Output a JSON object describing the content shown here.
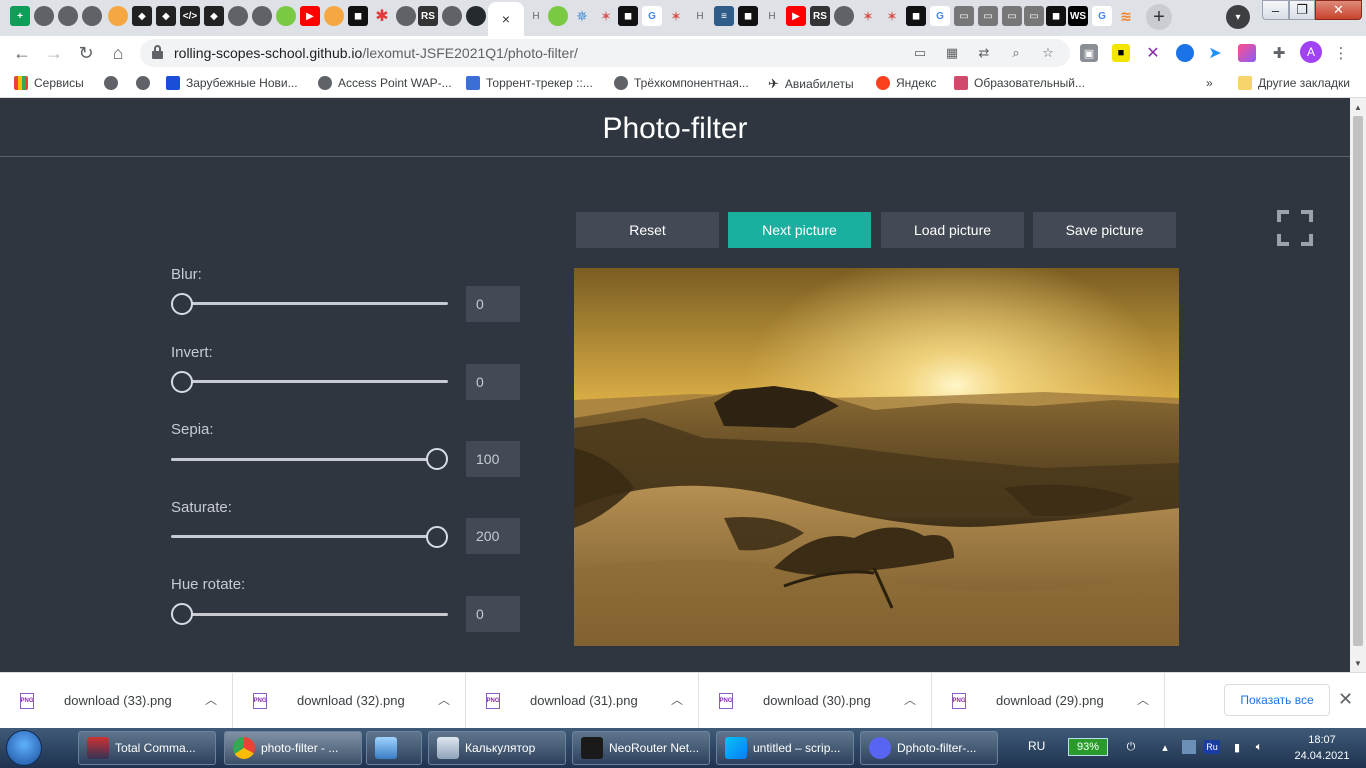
{
  "browser": {
    "url_domain": "rolling-scopes-school.github.io",
    "url_path": "/lexomut-JSFE2021Q1/photo-filter/",
    "tab_labels": [
      "H",
      "H",
      "H",
      "RS",
      "RS",
      "WS",
      "RS"
    ],
    "active_tab_close": "×",
    "new_tab": "+",
    "window_controls": {
      "minimize": "–",
      "maximize": "❐",
      "close": "✕"
    },
    "avatar_letter": "A"
  },
  "bookmarks": {
    "items": [
      "Сервисы",
      "Зарубежные Нови...",
      "Access Point WAP-...",
      "Торрент-трекер ::...",
      "Трёхкомпонентная...",
      "Авиабилеты",
      "Яндекс",
      "Образовательный..."
    ],
    "more": "»",
    "other": "Другие закладки"
  },
  "app": {
    "title": "Photo-filter",
    "filters": [
      {
        "label": "Blur:",
        "value": "0",
        "level": 0
      },
      {
        "label": "Invert:",
        "value": "0",
        "level": 0
      },
      {
        "label": "Sepia:",
        "value": "100",
        "level": 1
      },
      {
        "label": "Saturate:",
        "value": "200",
        "level": 1
      },
      {
        "label": "Hue rotate:",
        "value": "0",
        "level": 0
      }
    ],
    "buttons": {
      "reset": "Reset",
      "next": "Next picture",
      "load": "Load picture",
      "save": "Save picture"
    },
    "accent_color": "#1ab0a0"
  },
  "downloads": {
    "files": [
      "download (33).png",
      "download (32).png",
      "download (31).png",
      "download (30).png",
      "download (29).png"
    ],
    "file_icon_text": "PNG",
    "show_all": "Показать все",
    "close": "✕"
  },
  "taskbar": {
    "tasks": [
      "Total Comma...",
      "photo-filter - ...",
      "",
      "Калькулятор",
      "NeoRouter Net...",
      "untitled – scrip...",
      "Dphoto-filter-..."
    ],
    "language": "RU",
    "battery": "93%",
    "tray_lang": "Ru",
    "time": "18:07",
    "date": "24.04.2021"
  }
}
